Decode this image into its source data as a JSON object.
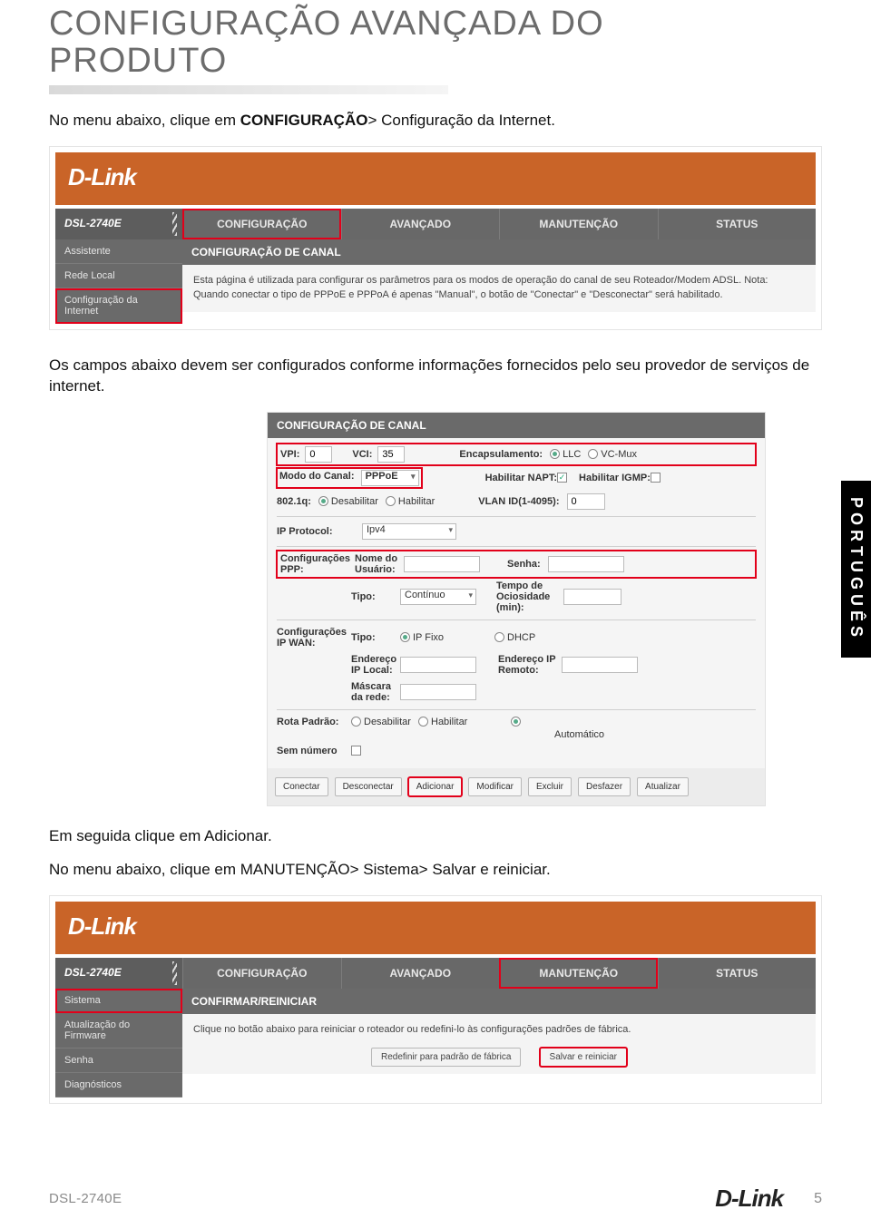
{
  "page": {
    "title_line1": "CONFIGURAÇÃO AVANÇADA DO",
    "title_line2": "PRODUTO",
    "intro1a": "No menu abaixo, clique em ",
    "intro1b": "CONFIGURAÇÃO",
    "intro1c": "> Configuração da Internet.",
    "intro2": "Os campos abaixo devem ser configurados conforme informações fornecidos pelo seu provedor de serviços de internet.",
    "intro3": "Em seguida clique em Adicionar.",
    "intro4": "No menu abaixo, clique em MANUTENÇÃO> Sistema> Salvar e reiniciar.",
    "lang_sidebar": "PORTUGUÊS"
  },
  "footer": {
    "model": "DSL-2740E",
    "logo": "D-Link",
    "page_number": "5"
  },
  "shot1": {
    "logo": "D-Link",
    "model": "DSL-2740E",
    "tabs": [
      "CONFIGURAÇÃO",
      "AVANÇADO",
      "MANUTENÇÃO",
      "STATUS"
    ],
    "sidebar": [
      "Assistente",
      "Rede Local",
      "Configuração da Internet"
    ],
    "section_header": "CONFIGURAÇÃO DE CANAL",
    "section_body": "Esta página é utilizada para configurar os parâmetros para os modos de operação do canal de seu Roteador/Modem ADSL. Nota: Quando conectar o tipo de PPPoE e PPPoA é apenas \"Manual\", o botão de \"Conectar\" e \"Desconectar\" será habilitado."
  },
  "shot2": {
    "header": "CONFIGURAÇÃO DE CANAL",
    "vpi_label": "VPI:",
    "vpi_value": "0",
    "vci_label": "VCI:",
    "vci_value": "35",
    "encap_label": "Encapsulamento:",
    "encap_opts": [
      "LLC",
      "VC-Mux"
    ],
    "mode_label": "Modo do Canal:",
    "mode_value": "PPPoE",
    "napt_label": "Habilitar NAPT:",
    "igmp_label": "Habilitar IGMP:",
    "dot1q_label": "802.1q:",
    "dot1q_opts": [
      "Desabilitar",
      "Habilitar"
    ],
    "vlan_label": "VLAN ID(1-4095):",
    "vlan_value": "0",
    "ipproto_label": "IP Protocol:",
    "ipproto_value": "Ipv4",
    "ppp_group_label": "Configurações PPP:",
    "ppp_user_label": "Nome do Usuário:",
    "ppp_pass_label": "Senha:",
    "ppp_type_label": "Tipo:",
    "ppp_type_value": "Contínuo",
    "idle_label": "Tempo de Ociosidade (min):",
    "wan_group_label": "Configurações IP WAN:",
    "wan_type_label": "Tipo:",
    "wan_type_opts": [
      "IP Fixo",
      "DHCP"
    ],
    "wan_local_label": "Endereço IP Local:",
    "wan_remote_label": "Endereço IP Remoto:",
    "wan_mask_label": "Máscara da rede:",
    "defroute_label": "Rota Padrão:",
    "defroute_opts": [
      "Desabilitar",
      "Habilitar",
      "Automático"
    ],
    "unnum_label": "Sem número",
    "buttons": [
      "Conectar",
      "Desconectar",
      "Adicionar",
      "Modificar",
      "Excluir",
      "Desfazer",
      "Atualizar"
    ]
  },
  "shot3": {
    "logo": "D-Link",
    "model": "DSL-2740E",
    "tabs": [
      "CONFIGURAÇÃO",
      "AVANÇADO",
      "MANUTENÇÃO",
      "STATUS"
    ],
    "sidebar": [
      "Sistema",
      "Atualização do Firmware",
      "Senha",
      "Diagnósticos"
    ],
    "section_header": "CONFIRMAR/REINICIAR",
    "section_body": "Clique no botão abaixo para reiniciar o roteador ou redefini-lo às configurações padrões de fábrica.",
    "btn_factory": "Redefinir para padrão de fábrica",
    "btn_save": "Salvar e reiniciar"
  }
}
